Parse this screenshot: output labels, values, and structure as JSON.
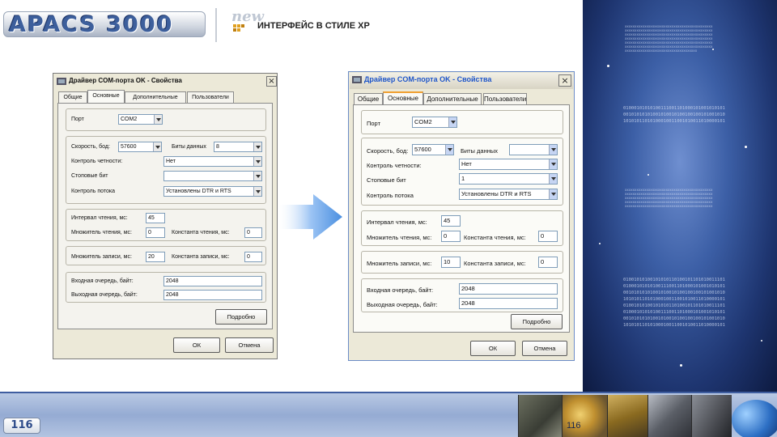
{
  "header": {
    "logo_text": "APACS 3000",
    "new_badge": "new",
    "title": "ИНТЕРФЕЙС В СТИЛЕ XP"
  },
  "footer": {
    "page_number": "116",
    "page_number_right": "116"
  },
  "colors": {
    "brand_blue": "#3d5f9c",
    "arrow_blue": "#4a8fe0",
    "xp_title_blue": "#1f56c9"
  },
  "dialog_classic": {
    "title": "Драйвер COM-порта OK - Свойства",
    "close_glyph": "×",
    "tabs": [
      "Общие",
      "Основные",
      "Дополнительные",
      "Пользователи"
    ],
    "active_tab": "Основные",
    "port_label": "Порт",
    "port_value": "COM2",
    "speed_label": "Скорость, бод:",
    "speed_value": "57600",
    "databits_label": "Биты данных",
    "databits_value": "8",
    "parity_label": "Контроль четности:",
    "parity_value": "Нет",
    "stopbits_label": "Стоповые бит",
    "stopbits_value": "",
    "flow_label": "Контроль потока",
    "flow_value": "Установлены DTR и RTS",
    "interval_label": "Интервал чтения, мс:",
    "interval_value": "45",
    "read_mult_label": "Множитель чтения, мс:",
    "read_mult_value": "0",
    "read_const_label": "Константа чтения, мс:",
    "read_const_value": "0",
    "write_mult_label": "Множитель записи, мс:",
    "write_mult_value": "20",
    "write_const_label": "Константа записи, мс:",
    "write_const_value": "0",
    "in_queue_label": "Входная очередь, байт:",
    "in_queue_value": "2048",
    "out_queue_label": "Выходная очередь, байт:",
    "out_queue_value": "2048",
    "advanced_button": "Подробно",
    "ok_button": "ОК",
    "cancel_button": "Отмена"
  },
  "dialog_xp": {
    "title": "Драйвер COM-порта OK - Свойства",
    "close_glyph": "×",
    "tabs": [
      "Общие",
      "Основные",
      "Дополнительные",
      "Пользователи"
    ],
    "active_tab": "Основные",
    "port_label": "Порт",
    "port_value": "COM2",
    "speed_label": "Скорость, бод:",
    "speed_value": "57600",
    "databits_label": "Биты данных",
    "databits_value": "",
    "parity_label": "Контроль четности:",
    "parity_value": "Нет",
    "stopbits_label": "Стоповые бит",
    "stopbits_value": "1",
    "flow_label": "Контроль потока",
    "flow_value": "Установлены DTR и RTS",
    "interval_label": "Интервал чтения, мс:",
    "interval_value": "45",
    "read_mult_label": "Множитель чтения, мс:",
    "read_mult_value": "0",
    "read_const_label": "Константа чтения, мс:",
    "read_const_value": "0",
    "write_mult_label": "Множитель записи, мс:",
    "write_mult_value": "10",
    "write_const_label": "Константа записи, мс:",
    "write_const_value": "0",
    "in_queue_label": "Входная очередь, байт:",
    "in_queue_value": "2048",
    "out_queue_label": "Выходная очередь, байт:",
    "out_queue_value": "2048",
    "advanced_button": "Подробно",
    "ok_button": "ОК",
    "cancel_button": "Отмена"
  },
  "background_code": {
    "binary_1": "01000101010100111001101000101001010101\n00101010101001010010100100100101001010\n10101011010100010011001010011010000101",
    "binary_2": "01001010100101010110100101101010011101\n01000101010100111001101000101001010101\n00101010101001010010100100100101001010\n10101011010100010011001010011010000101\n01001010100101010110100101101010011101\n01000101010100111001101000101001010101\n00101010101001010010100100100101001010\n10101011010100010011001010011010000101",
    "text_1": "xxxxxxxxxxxxxxxxxxxxxxxxxxxxxxxxxxxxxxxxxxxxx\nxxxxxxxxxxxxxxxxxxxxxxxxxxxxxxxxxxxxxxxxxxxxx\nxxxxxxxxxxxxxxxxxxxxxxxxxxxxxxxxxxxxxxxxxxxxx\nxxxxxxxxxxxxxxxxxxxxxxxxxxxxxxxxxxxxxxxxxxxxx\nxxxxxxxxxxxxxxxxxxxxxxxxxxxxxxxxxxxxxxxxxxxxx\nxxxxxxxxxxxxxxxxxxxxxxxxxxxxxxxxxxxxxxxxxxxxx\nxxxxxxxxxxxxxxxxxxxxxxxxxxxxxxxxxxxxx",
    "text_2": "xxxxxxxxxxxxxxxxxxxxxxxxxxxxxxxxxxxxxxxxxxxxx\nxxxxxxxxxxxxxxxxxxxxxxxxxxxxxxxxxxxxxxxxxxxxx\nxxxxxxxxxxxxxxxxxxxxxxxxxxxxxxxxxxxxxxxxxxxxx\nxxxxxxxxxxxxxxxxxxxxxxxxxxxxxxxxxxxxxxxxxxxxx\nxxxxxxxxxxxxxxxxxxxxxxxxxxxxxxxxxxxxxxxxxxxxx"
  }
}
